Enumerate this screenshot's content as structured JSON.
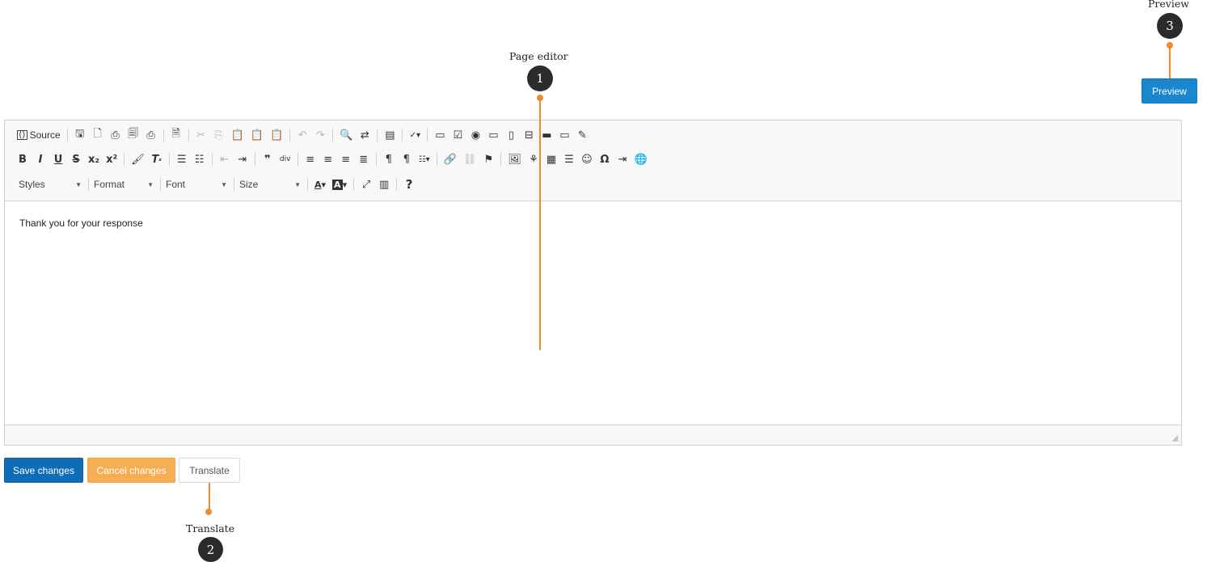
{
  "annotations": {
    "page_editor": {
      "label": "Page editor",
      "number": "1"
    },
    "translate": {
      "label": "Translate",
      "number": "2"
    },
    "preview": {
      "label": "Preview",
      "number": "3"
    }
  },
  "preview_button": "Preview",
  "toolbar": {
    "source_label": "Source",
    "styles_label": "Styles",
    "format_label": "Format",
    "font_label": "Font",
    "size_label": "Size",
    "help_label": "?"
  },
  "content": {
    "text": "Thank you for your response"
  },
  "buttons": {
    "save": "Save changes",
    "cancel": "Cancel changes",
    "translate": "Translate"
  },
  "colors": {
    "annotation_accent": "#ef8a2f",
    "preview_button": "#1b86d0",
    "save_button": "#0f6cb6",
    "cancel_button": "#f7ad52"
  }
}
